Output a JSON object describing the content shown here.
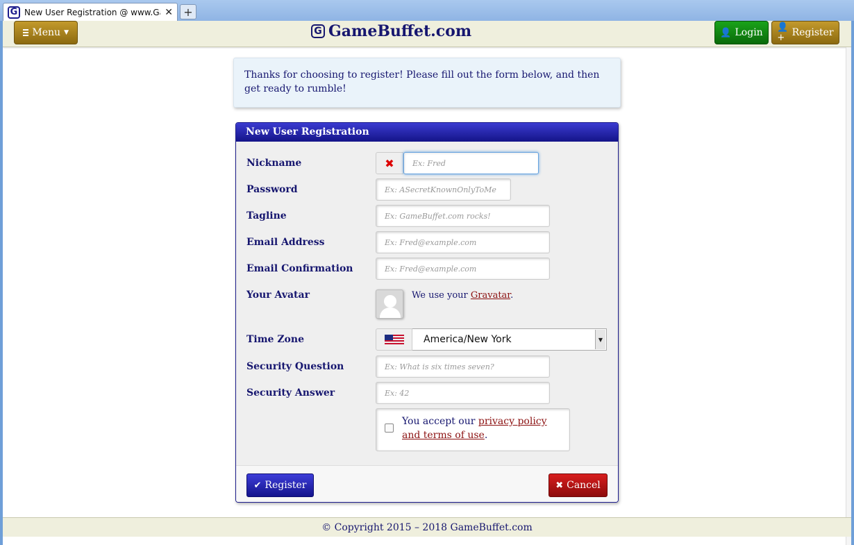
{
  "browser": {
    "tab_title": "New User Registration @ www.Game...",
    "favicon": "G",
    "close_glyph": "✕",
    "newtab_glyph": "+"
  },
  "navbar": {
    "menu_label": "Menu",
    "brand_logo": "G",
    "brand_name": "GameBuffet.com",
    "login_label": "Login",
    "register_label": "Register"
  },
  "info_text": "Thanks for choosing to register! Please fill out the form below, and then get ready to rumble!",
  "form": {
    "title": "New User Registration",
    "nickname": {
      "label": "Nickname",
      "placeholder": "Ex: Fred"
    },
    "password": {
      "label": "Password",
      "placeholder": "Ex: ASecretKnownOnlyToMe"
    },
    "tagline": {
      "label": "Tagline",
      "placeholder": "Ex: GameBuffet.com rocks!"
    },
    "email": {
      "label": "Email Address",
      "placeholder": "Ex: Fred@example.com"
    },
    "email_confirm": {
      "label": "Email Confirmation",
      "placeholder": "Ex: Fred@example.com"
    },
    "avatar": {
      "label": "Your Avatar",
      "text_before": "We use your ",
      "link": "Gravatar",
      "text_after": "."
    },
    "timezone": {
      "label": "Time Zone",
      "value": "America/New York"
    },
    "security_question": {
      "label": "Security Question",
      "placeholder": "Ex: What is six times seven?"
    },
    "security_answer": {
      "label": "Security Answer",
      "placeholder": "Ex: 42"
    },
    "privacy": {
      "text_before": "You accept our ",
      "link": "privacy policy and terms of use",
      "text_after": "."
    },
    "register_button": "Register",
    "cancel_button": "Cancel"
  },
  "footer": {
    "copyright": "© Copyright 2015 – 2018 GameBuffet.com"
  },
  "icons": {
    "nickname_status": "close-icon",
    "timezone_flag": "us-flag-icon",
    "register": "checkmark-icon",
    "cancel": "close-icon",
    "login": "user-icon",
    "register_top": "user-plus-icon"
  },
  "colors": {
    "brand": "#16166f",
    "gold": "#a27e1c",
    "green": "#128512",
    "blue": "#1c1cae",
    "red": "#b01414"
  }
}
